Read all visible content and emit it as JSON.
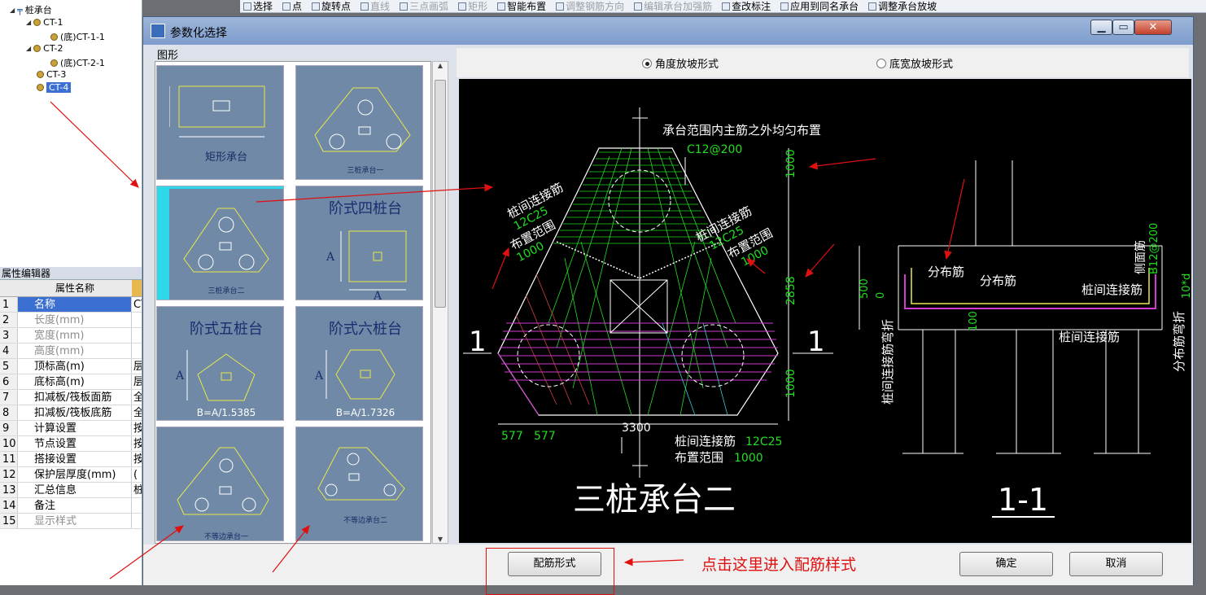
{
  "toolbar": {
    "items": [
      {
        "label": "选择",
        "disabled": false
      },
      {
        "label": "点",
        "disabled": false
      },
      {
        "label": "旋转点",
        "disabled": false
      },
      {
        "label": "直线",
        "disabled": true
      },
      {
        "label": "三点画弧",
        "disabled": true
      },
      {
        "label": "矩形",
        "disabled": true
      },
      {
        "label": "智能布置",
        "disabled": false
      },
      {
        "label": "调整钢筋方向",
        "disabled": true
      },
      {
        "label": "编辑承台加强筋",
        "disabled": true
      },
      {
        "label": "查改标注",
        "disabled": false
      },
      {
        "label": "应用到同名承台",
        "disabled": false
      },
      {
        "label": "调整承台放坡",
        "disabled": false
      }
    ]
  },
  "tree": {
    "root": "桩承台",
    "nodes": [
      "CT-1",
      "(底)CT-1-1",
      "CT-2",
      "(底)CT-2-1",
      "CT-3",
      "CT-4"
    ],
    "selected": "CT-4"
  },
  "properties": {
    "title": "属性编辑器",
    "header_name": "属性名称",
    "rows": [
      {
        "num": "1",
        "name": "名称",
        "value": "CT"
      },
      {
        "num": "2",
        "name": "长度(mm)",
        "value": ""
      },
      {
        "num": "3",
        "name": "宽度(mm)",
        "value": ""
      },
      {
        "num": "4",
        "name": "高度(mm)",
        "value": ""
      },
      {
        "num": "5",
        "name": "顶标高(m)",
        "value": "层"
      },
      {
        "num": "6",
        "name": "底标高(m)",
        "value": "层"
      },
      {
        "num": "7",
        "name": "扣减板/筏板面筋",
        "value": "全"
      },
      {
        "num": "8",
        "name": "扣减板/筏板底筋",
        "value": "全"
      },
      {
        "num": "9",
        "name": "计算设置",
        "value": "按"
      },
      {
        "num": "10",
        "name": "节点设置",
        "value": "按"
      },
      {
        "num": "11",
        "name": "搭接设置",
        "value": "按"
      },
      {
        "num": "12",
        "name": "保护层厚度(mm)",
        "value": "("
      },
      {
        "num": "13",
        "name": "汇总信息",
        "value": "桩"
      },
      {
        "num": "14",
        "name": "备注",
        "value": ""
      },
      {
        "num": "15",
        "name": "显示样式",
        "value": ""
      }
    ]
  },
  "dialog": {
    "title": "参数化选择",
    "panel_label": "图形",
    "thumbnails": [
      {
        "caption": "矩形承台",
        "selected": false
      },
      {
        "caption": "三桩承台一",
        "selected": false
      },
      {
        "caption": "三桩承台二",
        "selected": true
      },
      {
        "caption": "阶式四桩台",
        "selected": false
      },
      {
        "caption": "阶式五桩台",
        "formula": "B=A/1.5385",
        "selected": false
      },
      {
        "caption": "阶式六桩台",
        "formula": "B=A/1.7326",
        "selected": false
      },
      {
        "caption": "不等边承台一",
        "selected": false
      },
      {
        "caption": "不等边承台二",
        "selected": false
      }
    ],
    "radio_options": [
      {
        "label": "角度放坡形式",
        "checked": true
      },
      {
        "label": "底宽放坡形式",
        "checked": false
      }
    ],
    "drawing": {
      "main_title": "三桩承台二",
      "section_title": "1-1",
      "section_mark": "1",
      "note_top": "承台范围内主筋之外均匀布置",
      "rebar_top": "C12@200",
      "left_label_1": "桩间连接筋",
      "left_label_2": "12C25",
      "left_label_3": "布置范围",
      "left_label_4": "1000",
      "right_label_1": "桩间连接筋",
      "right_label_2": "12C25",
      "right_label_3": "布置范围",
      "right_label_4": "1000",
      "bottom_label_1": "桩间连接筋",
      "bottom_label_2": "12C25",
      "bottom_label_3": "布置范围",
      "bottom_label_4": "1000",
      "dim_1000_top": "1000",
      "dim_2858": "2858",
      "dim_1000_bot": "1000",
      "dim_577a": "577",
      "dim_577b": "577",
      "dim_3300": "3300",
      "sec_dist_1": "分布筋",
      "sec_dist_2": "分布筋",
      "sec_side": "侧面筋",
      "sec_side_val": "B12@200",
      "sec_link": "桩间连接筋",
      "sec_link2": "桩间连接筋",
      "sec_500": "500",
      "sec_0": "0",
      "sec_100": "100",
      "sec_10d": "10*d",
      "sec_left_vert": "桩间连接筋弯折",
      "sec_right_vert": "分布筋弯折"
    },
    "buttons": {
      "rebar_style": "配筋形式",
      "ok": "确定",
      "cancel": "取消"
    },
    "annotation": "点击这里进入配筋样式"
  },
  "colors": {
    "cad_bg": "#000000",
    "cad_white": "#ffffff",
    "cad_green": "#22dd22",
    "cad_yellow": "#e8e84a",
    "cad_magenta": "#d23ad2",
    "cad_red": "#d24040",
    "annotation_red": "#e01010",
    "thumb_bg": "#6f89a6",
    "thumb_selected": "#2fd8e8"
  }
}
